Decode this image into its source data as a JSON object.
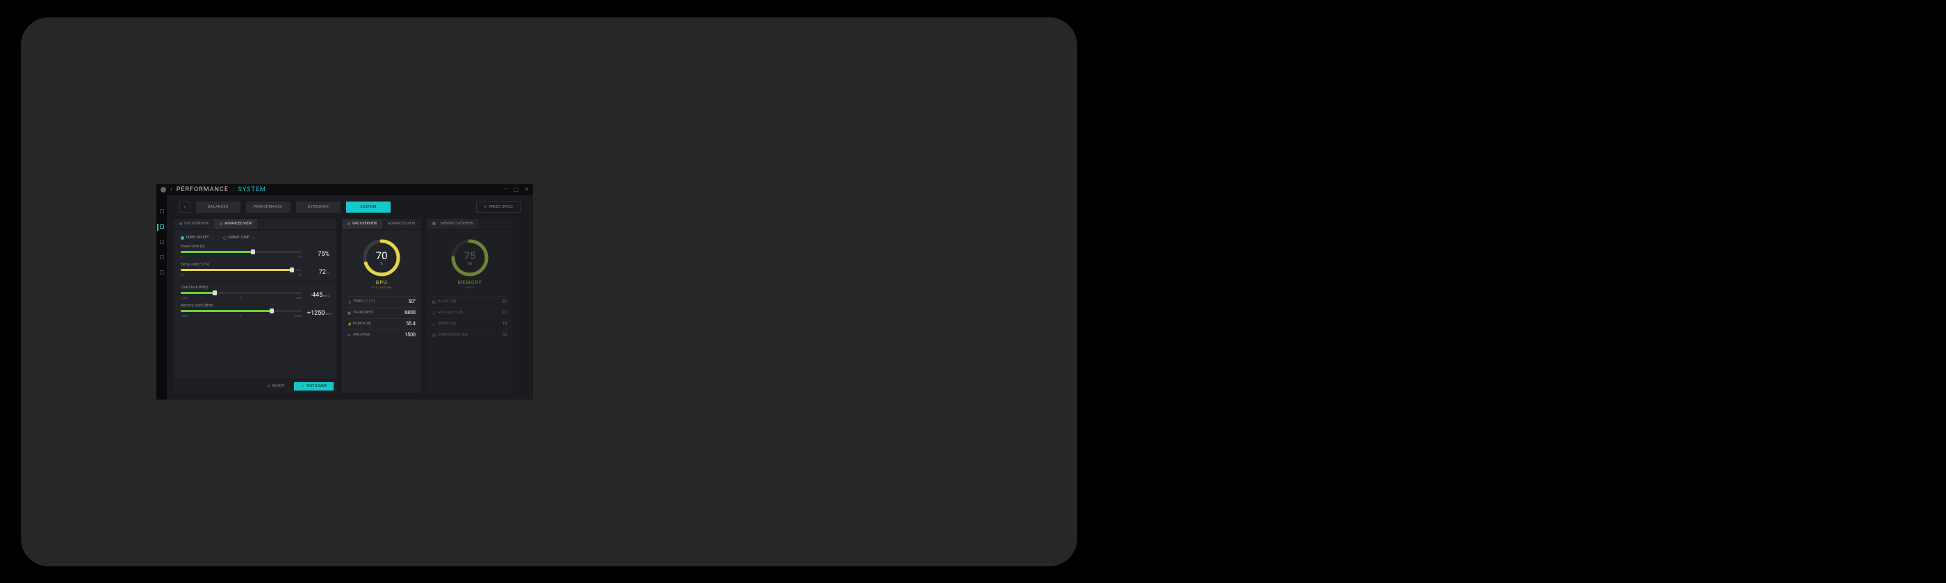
{
  "titlebar": {
    "section": "PERFORMANCE",
    "page": "SYSTEM",
    "back": "‹",
    "sep": "|",
    "min": "–",
    "max": "▢",
    "close": "✕"
  },
  "profiles": {
    "arrow": "‹",
    "items": [
      "BALANCED",
      "PERFORMANCE",
      "OVERDRIVE",
      "CUSTOM"
    ],
    "activeIndex": 3,
    "preset": "PRESET SPECS",
    "presetIcon": "⟳"
  },
  "cpu": {
    "tabs": [
      "CPU OVERVIEW",
      "ADVANCED VIEW"
    ],
    "activeTab": 1,
    "modes": [
      "FIXED OFFSET",
      "SMART TUNE"
    ],
    "modeActive": 0,
    "info": "ⓘ",
    "sliders": {
      "power": {
        "label": "Power Limit (%)",
        "min": "0",
        "max": "125",
        "value": "75%",
        "fillPct": 60,
        "color": "#6cd23a"
      },
      "temp": {
        "label": "Temp Limit (°C/°F)",
        "min": "32",
        "max": "90",
        "value": "72",
        "unit": "°C",
        "fillPct": 92,
        "color": "#e5d547"
      },
      "core": {
        "label": "Core Clock (MHz)",
        "min": "-1000",
        "mid": "0",
        "max": "+1000",
        "value": "-445",
        "unit": "MHZ",
        "fillPct": 28,
        "color": "#6cd23a"
      },
      "mem": {
        "label": "Memory Clock (MHz)",
        "min": "-2500",
        "mid": "0",
        "max": "+2500",
        "value": "+1250",
        "unit": "MHZ",
        "fillPct": 75,
        "color": "#6cd23a"
      }
    },
    "revert": "REVERT",
    "revertIcon": "↺",
    "save": "TEST & SAVE",
    "saveIcon": "✓"
  },
  "gpu": {
    "tabs": [
      "GPU OVERVIEW",
      "ADVANCED VIEW"
    ],
    "activeTab": 0,
    "gauge": {
      "value": "70",
      "unit": "%",
      "title": "GPU",
      "subtitle": "UTILIZATION",
      "pct": 70,
      "color": "#e5d547"
    },
    "stats": [
      {
        "icon": "🌡",
        "label": "TEMP (°C | °F)",
        "value": "50°"
      },
      {
        "icon": "▦",
        "label": "VRAM (MHZ)",
        "value": "6800"
      },
      {
        "icon": "⚡",
        "label": "POWER (W)",
        "value": "55.4"
      },
      {
        "icon": "✳",
        "label": "FAN (RPM)",
        "value": "1500"
      }
    ]
  },
  "memory": {
    "tab": "MEMORY OVERVIEW",
    "tabIcon": "▦",
    "gauge": {
      "value": "75",
      "unit": "GB",
      "title": "MEMORY",
      "subtitle": "SPEED",
      "pct": 75,
      "color": "#b8d547"
    },
    "stats": [
      {
        "icon": "◧",
        "label": "IN USE (GB)",
        "value": "90"
      },
      {
        "icon": "◫",
        "label": "AVAILABLE (GB)",
        "value": "33"
      },
      {
        "icon": "⎓",
        "label": "WIRED (GB)",
        "value": "18"
      },
      {
        "icon": "▤",
        "label": "COMPRESSED (GB)",
        "value": "38"
      }
    ]
  }
}
